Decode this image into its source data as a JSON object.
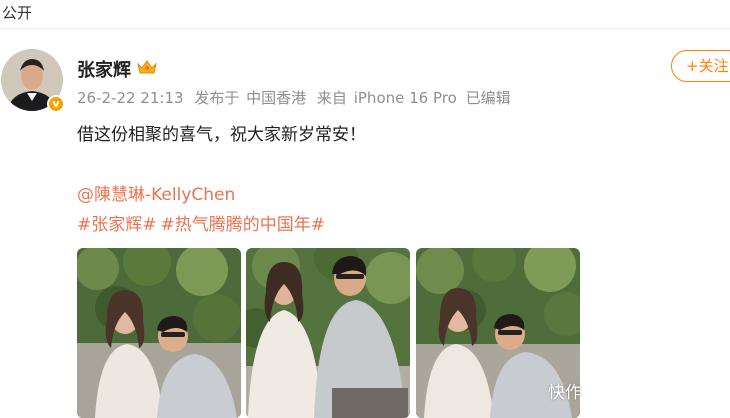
{
  "header": {
    "scope_label": "公开"
  },
  "post": {
    "author": "张家辉",
    "timestamp": "26-2-22 21:13",
    "published_label": "发布于",
    "location": "中国香港",
    "source_label": "来自",
    "device": "iPhone 16 Pro",
    "edited_label": "已编辑",
    "follow_label": "+关注",
    "text": "借这份相聚的喜气，祝大家新岁常安！",
    "mention": "@陳慧琳-KellyChen",
    "hashtags": [
      "#张家辉#",
      "#热气腾腾的中国年#"
    ],
    "images": [
      {
        "alt": "photo-1"
      },
      {
        "alt": "photo-2"
      },
      {
        "alt": "photo-3"
      }
    ],
    "watermark": "快作"
  },
  "colors": {
    "accent": "#ff8200",
    "link": "#eb7350",
    "meta": "#8f8f8f",
    "verified": "#f5a300"
  }
}
